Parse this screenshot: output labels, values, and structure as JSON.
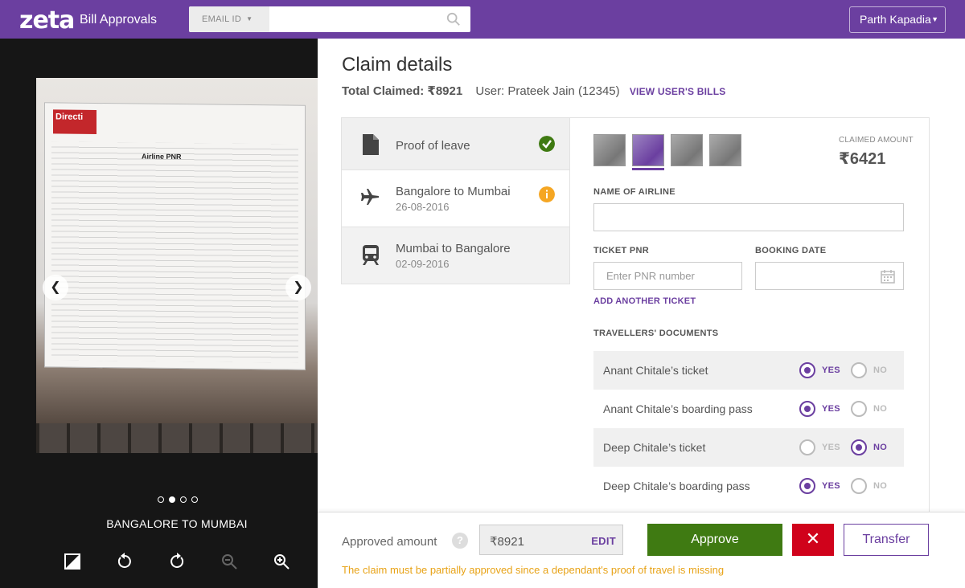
{
  "header": {
    "logo": "zeta",
    "app_title": "Bill Approvals",
    "search": {
      "type_label": "EMAIL ID",
      "placeholder": ""
    },
    "user_name": "Parth Kapadia"
  },
  "viewer": {
    "doc_text": {
      "brand": "Directi",
      "heading": "Airline PNR"
    },
    "caption": "BANGALORE TO MUMBAI",
    "dots": [
      false,
      true,
      false,
      false
    ],
    "tools": [
      "crop-icon",
      "rotate-left-icon",
      "rotate-right-icon",
      "zoom-out-icon",
      "zoom-in-icon"
    ]
  },
  "claim": {
    "title": "Claim details",
    "total_claimed": "Total Claimed: ₹8921",
    "user": "User: Prateek Jain (12345)",
    "view_bills": "VIEW USER'S BILLS"
  },
  "items": [
    {
      "title": "Proof of leave",
      "date": "",
      "icon": "document-icon",
      "status": "verified"
    },
    {
      "title": "Bangalore to Mumbai",
      "date": "26-08-2016",
      "icon": "airplane-icon",
      "status": "info"
    },
    {
      "title": "Mumbai to Bangalore",
      "date": "02-09-2016",
      "icon": "train-icon",
      "status": "none"
    }
  ],
  "panel": {
    "claimed_label": "CLAIMED AMOUNT",
    "claimed_value": "₹6421",
    "airline_label": "NAME OF AIRLINE",
    "airline_value": "",
    "pnr_label": "TICKET PNR",
    "pnr_placeholder": "Enter PNR number",
    "booking_label": "BOOKING DATE",
    "booking_value": "",
    "add_ticket": "ADD ANOTHER TICKET",
    "docs_label": "TRAVELLERS' DOCUMENTS",
    "yes_label": "YES",
    "no_label": "NO",
    "docs": [
      {
        "name": "Anant Chitale’s ticket",
        "value": "yes"
      },
      {
        "name": "Anant Chitale’s boarding pass",
        "value": "yes"
      },
      {
        "name": "Deep Chitale’s ticket",
        "value": "no"
      },
      {
        "name": "Deep Chitale’s boarding pass",
        "value": "yes"
      }
    ]
  },
  "footer": {
    "approved_label": "Approved amount",
    "help": "?",
    "amount": "₹8921",
    "edit": "EDIT",
    "approve": "Approve",
    "reject": "✕",
    "transfer": "Transfer",
    "warning": "The claim must be partially approved since a dependant's proof of travel is missing"
  },
  "colors": {
    "brand": "#6b3fa0",
    "approve": "#3f7a12",
    "reject": "#d0021b",
    "warning": "#e8a317",
    "success": "#3f7a12",
    "info": "#f5a623"
  }
}
